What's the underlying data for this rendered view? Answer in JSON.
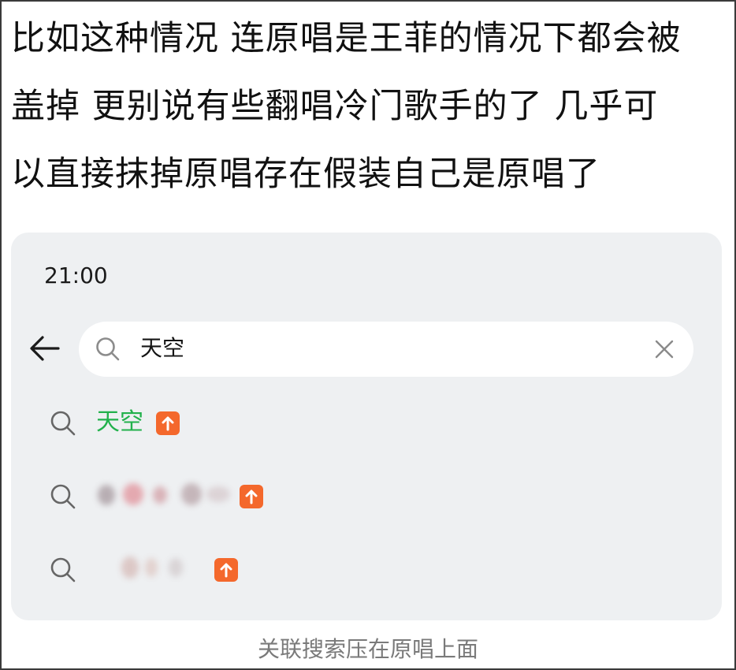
{
  "caption": {
    "lines": [
      "比如这种情况 连原唱是王菲的情况下都会被",
      "盖掉 更别说有些翻唱冷门歌手的了 几乎可",
      "以直接抹掉原唱存在假装自己是原唱了"
    ]
  },
  "phone": {
    "status_time": "21:00",
    "back_icon": "arrow-left-icon",
    "search": {
      "icon": "search-icon",
      "query": "天空",
      "clear_icon": "close-icon"
    },
    "suggestions": [
      {
        "label": "天空",
        "badge_icon": "arrow-up-icon",
        "label_color": "#22b14c"
      },
      {
        "label": "",
        "badge_icon": "arrow-up-icon",
        "obscured": true
      },
      {
        "label": "",
        "badge_icon": "arrow-up-icon",
        "obscured": true
      }
    ]
  },
  "footer": {
    "text": "关联搜索压在原唱上面"
  },
  "colors": {
    "panel_bg": "#eef0f2",
    "highlight_green": "#22b14c",
    "badge_orange": "#f4682c",
    "footer_gray": "#7a7a7a"
  }
}
